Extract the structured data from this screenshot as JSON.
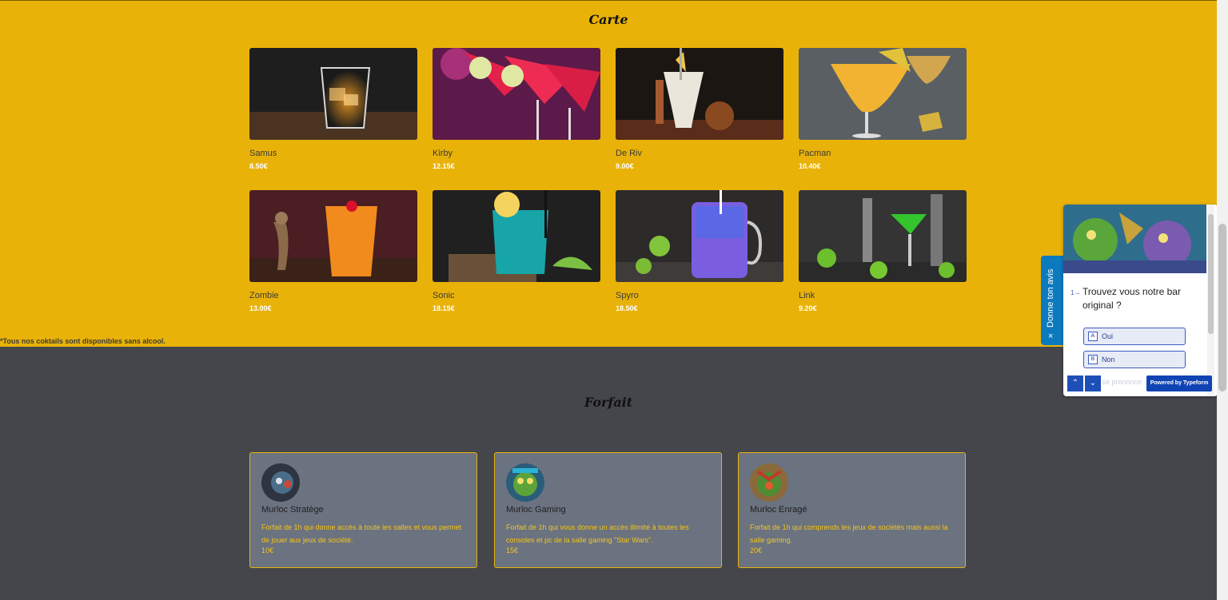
{
  "carte": {
    "title": "Carte",
    "items": [
      {
        "name": "Samus",
        "price": "8.50€"
      },
      {
        "name": "Kirby",
        "price": "12.15€"
      },
      {
        "name": "De Riv",
        "price": "9.00€"
      },
      {
        "name": "Pacman",
        "price": "10.40€"
      },
      {
        "name": "Zombie",
        "price": "13.00€"
      },
      {
        "name": "Sonic",
        "price": "18.15€"
      },
      {
        "name": "Spyro",
        "price": "18.50€"
      },
      {
        "name": "Link",
        "price": "9.20€"
      }
    ],
    "footnote": "*Tous nos coktails sont disponibles sans alcool."
  },
  "forfait": {
    "title": "Forfait",
    "cards": [
      {
        "name": "Murloc Stratège",
        "desc": "Forfait de 1h qui donne accès à toute les salles et vous permet de jouer aux jeux de société.",
        "price": "10€"
      },
      {
        "name": "Murloc Gaming",
        "desc": "Forfait de 1h qui vous donne un accès illimité à toutes les consoles et pc de la salle gaming \"Star Wars\".",
        "price": "15€"
      },
      {
        "name": "Murloc Enragé",
        "desc": "Forfait de 1h qui comprends les jeux de sociétés mais aussi la salle gaming.",
        "price": "20€"
      }
    ]
  },
  "typeform": {
    "tab_label": "Donne ton avis",
    "tab_close": "×",
    "question_number": "1→",
    "question": "Trouvez vous notre bar original ?",
    "choices": [
      {
        "key": "A",
        "label": "Oui"
      },
      {
        "key": "B",
        "label": "Non"
      }
    ],
    "hidden_choice": "ne se prononce",
    "nav_up": "⌃",
    "nav_down": "⌄",
    "powered": "Powered by Typeform"
  },
  "colors": {
    "accent": "#e9b208",
    "dark_bg": "#45464b",
    "card_bg": "#6b7280",
    "typeform_blue": "#0c7abf"
  }
}
